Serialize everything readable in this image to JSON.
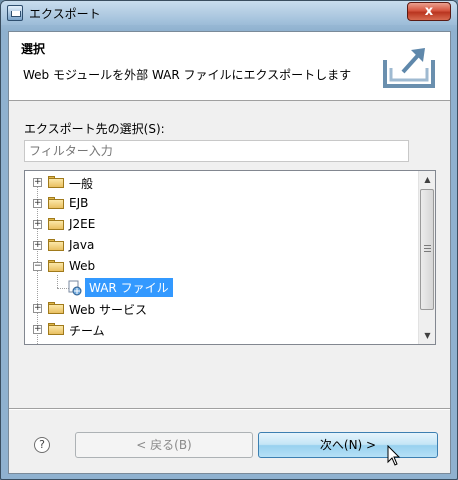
{
  "window": {
    "title": "エクスポート",
    "close_symbol": "x"
  },
  "header": {
    "title": "選択",
    "description": "Web モジュールを外部 WAR ファイルにエクスポートします",
    "graphic_icon": "export-wizard-icon"
  },
  "selection": {
    "label": "エクスポート先の選択(S):",
    "filter_placeholder": "フィルター入力"
  },
  "tree": {
    "items": [
      {
        "label": "一般",
        "expanded": false
      },
      {
        "label": "EJB",
        "expanded": false
      },
      {
        "label": "J2EE",
        "expanded": false
      },
      {
        "label": "Java",
        "expanded": false
      },
      {
        "label": "Web",
        "expanded": true
      },
      {
        "label": "WAR ファイル",
        "child": true,
        "selected": true
      },
      {
        "label": "Web サービス",
        "expanded": false
      },
      {
        "label": "チーム",
        "expanded": false
      }
    ],
    "expander_collapsed": "+",
    "expander_expanded": "−"
  },
  "scrollbar": {
    "up_symbol": "▲",
    "down_symbol": "▼"
  },
  "footer": {
    "help_symbol": "?",
    "back_label": "< 戻る(B)",
    "next_label": "次へ(N) >"
  },
  "colors": {
    "selection": "#3399ff",
    "folder": "#e9c061",
    "close_button": "#c8452f"
  }
}
